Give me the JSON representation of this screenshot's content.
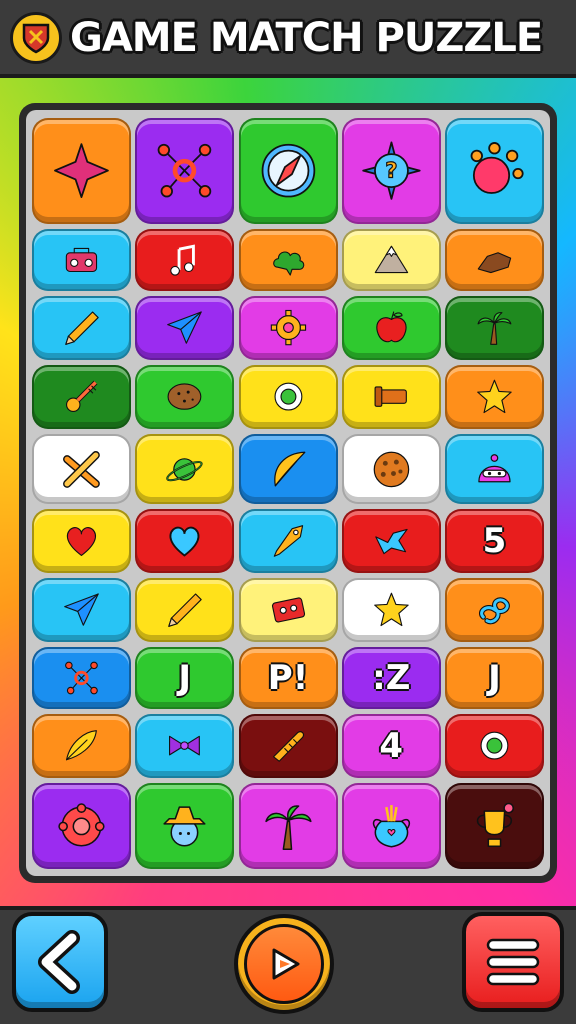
{
  "header": {
    "title": "GAME MATCH PUZZLE",
    "logo_icon": "shield-icon"
  },
  "colors": {
    "orange": "#ff8f1a",
    "purple": "#9b2cf0",
    "green": "#2fc92f",
    "magenta": "#e23ce6",
    "cyan": "#28c4f5",
    "red": "#e81d1d",
    "yellow": "#ffe11a",
    "darkgreen": "#1f8a1f",
    "white": "#ffffff",
    "blue": "#1a8ff0",
    "maroon": "#7a0f0f",
    "darkmaroon": "#4a0d0d",
    "lightyellow": "#fff27a"
  },
  "board": {
    "rows": [
      [
        {
          "bg": "orange",
          "icon": "spiky-gem-icon"
        },
        {
          "bg": "purple",
          "icon": "molecule-icon"
        },
        {
          "bg": "green",
          "icon": "compass-icon"
        },
        {
          "bg": "magenta",
          "icon": "question-compass-icon"
        },
        {
          "bg": "cyan",
          "icon": "splat-icon"
        }
      ],
      [
        {
          "bg": "cyan",
          "icon": "radio-icon"
        },
        {
          "bg": "red",
          "icon": "music-note-icon"
        },
        {
          "bg": "orange",
          "icon": "cloud-icon"
        },
        {
          "bg": "lightyellow",
          "icon": "mountain-icon"
        },
        {
          "bg": "orange",
          "icon": "rock-icon"
        }
      ],
      [
        {
          "bg": "cyan",
          "icon": "pencil-icon"
        },
        {
          "bg": "purple",
          "icon": "paper-plane-icon"
        },
        {
          "bg": "magenta",
          "icon": "gear-icon"
        },
        {
          "bg": "green",
          "icon": "apple-icon"
        },
        {
          "bg": "darkgreen",
          "icon": "palm-tree-icon"
        }
      ],
      [
        {
          "bg": "darkgreen",
          "icon": "key-icon"
        },
        {
          "bg": "green",
          "icon": "potato-icon"
        },
        {
          "bg": "yellow",
          "icon": "ring-icon"
        },
        {
          "bg": "yellow",
          "icon": "pipe-icon"
        },
        {
          "bg": "orange",
          "icon": "star-icon"
        }
      ],
      [
        {
          "bg": "white",
          "icon": "crossed-bones-icon"
        },
        {
          "bg": "yellow",
          "icon": "planet-icon"
        },
        {
          "bg": "blue",
          "icon": "leaf-icon"
        },
        {
          "bg": "white",
          "icon": "cookie-icon"
        },
        {
          "bg": "cyan",
          "icon": "ninja-icon"
        }
      ],
      [
        {
          "bg": "yellow",
          "icon": "heart-icon"
        },
        {
          "bg": "red",
          "icon": "heart-outline-icon"
        },
        {
          "bg": "cyan",
          "icon": "pen-nib-icon"
        },
        {
          "bg": "red",
          "icon": "bird-icon"
        },
        {
          "bg": "red",
          "icon": "number-icon",
          "glyph": "5"
        }
      ],
      [
        {
          "bg": "cyan",
          "icon": "paper-plane-icon"
        },
        {
          "bg": "yellow",
          "icon": "pencil-icon"
        },
        {
          "bg": "lightyellow",
          "icon": "cassette-icon"
        },
        {
          "bg": "white",
          "icon": "star-icon"
        },
        {
          "bg": "orange",
          "icon": "knot-icon"
        }
      ],
      [
        {
          "bg": "blue",
          "icon": "molecule-icon"
        },
        {
          "bg": "green",
          "icon": "letter-icon",
          "glyph": "J"
        },
        {
          "bg": "orange",
          "icon": "letter-icon",
          "glyph": "P!"
        },
        {
          "bg": "purple",
          "icon": "letter-icon",
          "glyph": ":Z"
        },
        {
          "bg": "orange",
          "icon": "letter-icon",
          "glyph": "J"
        }
      ],
      [
        {
          "bg": "orange",
          "icon": "feather-icon"
        },
        {
          "bg": "cyan",
          "icon": "bow-icon"
        },
        {
          "bg": "maroon",
          "icon": "bread-icon"
        },
        {
          "bg": "magenta",
          "icon": "number-icon",
          "glyph": "4"
        },
        {
          "bg": "red",
          "icon": "ring-icon"
        }
      ],
      [
        {
          "bg": "purple",
          "icon": "flower-icon"
        },
        {
          "bg": "green",
          "icon": "hat-face-icon"
        },
        {
          "bg": "magenta",
          "icon": "palm-tree-icon"
        },
        {
          "bg": "magenta",
          "icon": "vase-icon"
        },
        {
          "bg": "darkmaroon",
          "icon": "trophy-icon"
        }
      ]
    ]
  },
  "footer": {
    "back_icon": "chevron-left-icon",
    "play_icon": "play-icon",
    "menu_icon": "hamburger-menu-icon"
  }
}
